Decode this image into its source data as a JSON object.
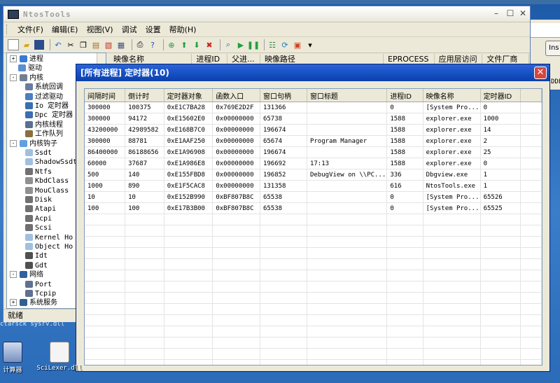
{
  "app": {
    "title": "NtosTools",
    "menus": [
      "文件(F)",
      "编辑(E)",
      "视图(V)",
      "调试",
      "设置",
      "帮助(H)"
    ],
    "status": "就绪",
    "list_headers": [
      "映像名称",
      "进程ID",
      "父进...",
      "映像路径",
      "EPROCESS",
      "应用层访问",
      "文件厂商"
    ],
    "right_button": "Ins",
    "right_side_text": "DDE"
  },
  "tree": [
    {
      "label": "进程",
      "level": 0,
      "expander": "+",
      "icon": "process-icon"
    },
    {
      "label": "驱动",
      "level": 0,
      "expander": "",
      "icon": "driver-icon"
    },
    {
      "label": "内核",
      "level": 0,
      "expander": "-",
      "icon": "kernel-icon"
    },
    {
      "label": "系统回调",
      "level": 1,
      "expander": "",
      "icon": "callback-icon"
    },
    {
      "label": "过滤驱动",
      "level": 1,
      "expander": "",
      "icon": "filter-icon"
    },
    {
      "label": "Io 定时器",
      "level": 1,
      "expander": "",
      "icon": "timer-icon"
    },
    {
      "label": "Dpc 定时器",
      "level": 1,
      "expander": "",
      "icon": "timer-icon"
    },
    {
      "label": "内核线程",
      "level": 1,
      "expander": "",
      "icon": "thread-icon"
    },
    {
      "label": "工作队列",
      "level": 1,
      "expander": "",
      "icon": "queue-icon"
    },
    {
      "label": "内核钩子",
      "level": 0,
      "expander": "-",
      "icon": "hook-icon"
    },
    {
      "label": "Ssdt",
      "level": 1,
      "expander": "",
      "icon": "gear-icon"
    },
    {
      "label": "ShadowSsdt",
      "level": 1,
      "expander": "",
      "icon": "gear-icon"
    },
    {
      "label": "Ntfs",
      "level": 1,
      "expander": "",
      "icon": "disk-icon"
    },
    {
      "label": "KbdClass",
      "level": 1,
      "expander": "",
      "icon": "keyboard-icon"
    },
    {
      "label": "MouClass",
      "level": 1,
      "expander": "",
      "icon": "mouse-icon"
    },
    {
      "label": "Disk",
      "level": 1,
      "expander": "",
      "icon": "disk-icon"
    },
    {
      "label": "Atapi",
      "level": 1,
      "expander": "",
      "icon": "disk-icon"
    },
    {
      "label": "Acpi",
      "level": 1,
      "expander": "",
      "icon": "disk-icon"
    },
    {
      "label": "Scsi",
      "level": 1,
      "expander": "",
      "icon": "disk-icon"
    },
    {
      "label": "Kernel Ho",
      "level": 1,
      "expander": "",
      "icon": "gear-icon"
    },
    {
      "label": "Object Ho",
      "level": 1,
      "expander": "",
      "icon": "gear-icon"
    },
    {
      "label": "Idt",
      "level": 1,
      "expander": "",
      "icon": "chip-icon"
    },
    {
      "label": "Gdt",
      "level": 1,
      "expander": "",
      "icon": "chip-icon"
    },
    {
      "label": "网络",
      "level": 0,
      "expander": "-",
      "icon": "network-icon"
    },
    {
      "label": "Port",
      "level": 1,
      "expander": "",
      "icon": "port-icon"
    },
    {
      "label": "Tcpip",
      "level": 1,
      "expander": "",
      "icon": "port-icon"
    },
    {
      "label": "系统服务",
      "level": 0,
      "expander": "+",
      "icon": "service-icon"
    }
  ],
  "dialog": {
    "title": "[所有进程] 定时器(10)",
    "columns": [
      "间隔时间",
      "倒计时",
      "定时器对象",
      "函数入口",
      "窗口句柄",
      "窗口标题",
      "进程ID",
      "映像名称",
      "定时器ID"
    ],
    "rows": [
      [
        "300000",
        "100375",
        "0xE1C7BA28",
        "0x769E2D2F",
        "131366",
        "",
        "0",
        "[System Pro...",
        "0"
      ],
      [
        "300000",
        "94172",
        "0xE15602E0",
        "0x00000000",
        "65738",
        "",
        "1588",
        "explorer.exe",
        "1000"
      ],
      [
        "43200000",
        "42989582",
        "0xE168B7C0",
        "0x00000000",
        "196674",
        "",
        "1588",
        "explorer.exe",
        "14"
      ],
      [
        "300000",
        "88781",
        "0xE1AAF250",
        "0x00000000",
        "65674",
        "Program Manager",
        "1588",
        "explorer.exe",
        "2"
      ],
      [
        "86400000",
        "86188656",
        "0xE1A96908",
        "0x00000000",
        "196674",
        "",
        "1588",
        "explorer.exe",
        "25"
      ],
      [
        "60000",
        "37687",
        "0xE1A986E8",
        "0x00000000",
        "196692",
        "17:13",
        "1588",
        "explorer.exe",
        "0"
      ],
      [
        "500",
        "140",
        "0xE155FBD8",
        "0x00000000",
        "196852",
        "DebugView on \\\\PC...",
        "336",
        "Dbgview.exe",
        "1"
      ],
      [
        "1000",
        "890",
        "0xE1F5CAC8",
        "0x00000000",
        "131358",
        "",
        "616",
        "NtosTools.exe",
        "1"
      ],
      [
        "10",
        "10",
        "0xE152B990",
        "0xBF807B8C",
        "65538",
        "",
        "0",
        "[System Pro...",
        "65526"
      ],
      [
        "100",
        "100",
        "0xE17B3B00",
        "0xBF807B8C",
        "65538",
        "",
        "0",
        "[System Pro...",
        "65525"
      ]
    ]
  },
  "desktop": {
    "icons": [
      {
        "label": "计算器",
        "icon": "calculator-icon"
      },
      {
        "label": "SciLexer.dll",
        "icon": "dll-file-icon"
      }
    ],
    "behind_text": "ctarsck   sysrv.dll"
  },
  "colors": {
    "dialog_title": "#1852c6",
    "close_red": "#d6463c",
    "window_face": "#ece9d8",
    "desktop": "#2b6bb8"
  }
}
